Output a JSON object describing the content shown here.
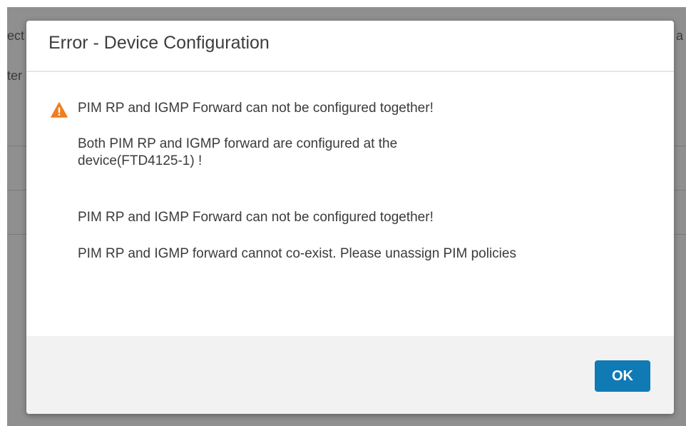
{
  "background": {
    "fragments": [
      "ect",
      "ter",
      "a"
    ]
  },
  "dialog": {
    "title": "Error - Device Configuration",
    "icon": "warning-triangle-icon",
    "messages": [
      "PIM RP and IGMP Forward can not be configured together!",
      "Both PIM RP and IGMP forward are configured  at the",
      "device(FTD4125-1) !",
      "PIM RP and IGMP Forward can not be configured together!",
      "PIM RP and IGMP forward cannot co-exist. Please unassign PIM policies"
    ],
    "ok_label": "OK"
  },
  "colors": {
    "accent": "#0f7ab4",
    "warning": "#f07e1e",
    "overlay": "#8f8f8f"
  }
}
